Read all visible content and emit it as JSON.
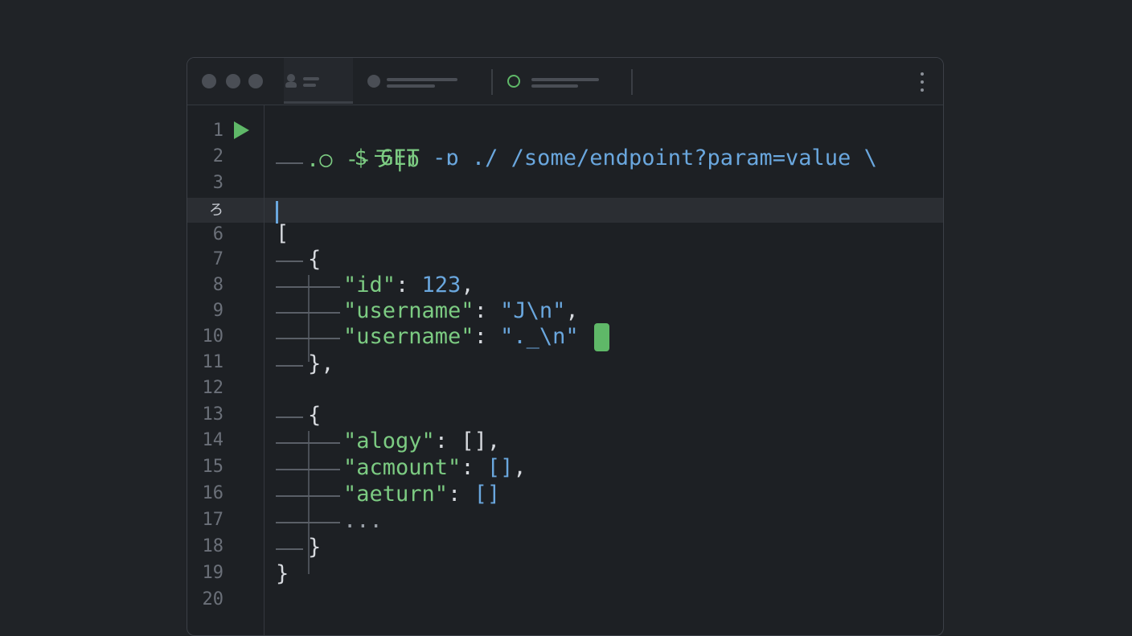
{
  "window": {
    "tabs": [
      {
        "name": "user-tab",
        "active": true
      },
      {
        "name": "dot-tab",
        "active": false
      },
      {
        "name": "ring-tab",
        "active": false
      }
    ]
  },
  "gutter": {
    "line_numbers": [
      "1",
      "2",
      "3",
      "ろ",
      "6",
      "7",
      "8",
      "9",
      "10",
      "11",
      "12",
      "13",
      "14",
      "15",
      "16",
      "17",
      "18",
      "19",
      "20"
    ],
    "current_line": "ろ"
  },
  "code": {
    "line1": {
      "prompt": "$",
      "cmd": "GET",
      "flag": "-ɒ",
      "path": "./ /some/endpoint?param=value \\"
    },
    "line2": {
      "text": ".○ --ラ|ɒ"
    },
    "line6": "[",
    "line7": "{",
    "line8": {
      "key": "\"id\"",
      "colon": ": ",
      "value": "123",
      "trail": ","
    },
    "line9": {
      "key": "\"username\"",
      "colon": ": ",
      "value": "\"J\\n\"",
      "trail": ","
    },
    "line10": {
      "key": "\"username\"",
      "colon": ": ",
      "value": "\"._\\n\"",
      "trail": ""
    },
    "line11": "},",
    "line13": "{",
    "line14": {
      "key": "\"alogy\"",
      "colon": ": ",
      "value": "[]",
      "trail": ","
    },
    "line15": {
      "key": "\"acmount\"",
      "colon": ": ",
      "value": "[]",
      "trail": ","
    },
    "line16": {
      "key": "\"aeturn\"",
      "colon": ": ",
      "value": "[]",
      "trail": ""
    },
    "line17": "...",
    "line18": "}",
    "line19": "}"
  },
  "colors": {
    "accent_green": "#5fb868",
    "string_green": "#7ccb82",
    "accent_blue": "#6aa7de",
    "background": "#1d2024"
  }
}
